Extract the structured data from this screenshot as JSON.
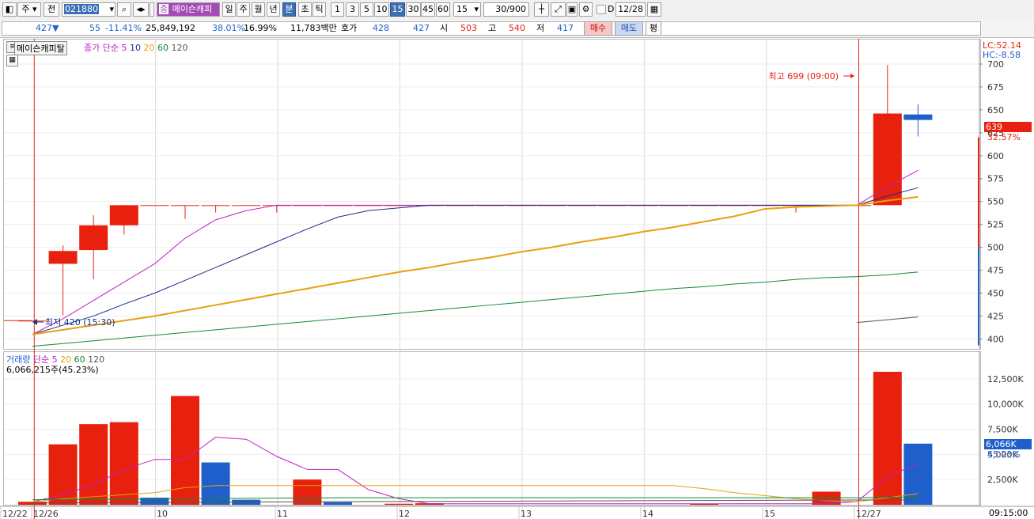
{
  "toolbar": {
    "market_btn": "주",
    "prev_btn": "전",
    "code": "021880",
    "stock_name": "메이슨캐피",
    "periods": [
      "일",
      "주",
      "월",
      "년",
      "분",
      "초",
      "틱"
    ],
    "active_period": "분",
    "intervals": [
      "1",
      "3",
      "5",
      "10",
      "15",
      "30",
      "45",
      "60"
    ],
    "active_interval": "15",
    "interval_select": "15",
    "count_value": "30",
    "count_total": "/900",
    "d_label": "D",
    "date_value": "12/28"
  },
  "infobar": {
    "price": "427",
    "price_arrow": "▼",
    "change": "55",
    "change_pct": "-11.41%",
    "volume": "25,849,192",
    "volume_ratio": "38.01%",
    "turnover": "16.99%",
    "amount": "11,783백만",
    "hoga_label": "호가",
    "hoga_ask": "428",
    "hoga_bid": "427",
    "open_label": "시",
    "open": "503",
    "high_label": "고",
    "high": "540",
    "low_label": "저",
    "low": "417",
    "buy_btn": "매수",
    "sell_btn": "매도",
    "avg_btn": "평"
  },
  "price_panel": {
    "stock_label": "메이슨캐피탈",
    "ma_title": "종가 단순",
    "ma_periods": [
      "5",
      "10",
      "20",
      "60",
      "120"
    ],
    "lc": "LC:52.14",
    "hc": "HC:-8.58",
    "current_price_tag": "639",
    "current_pct": "32.57%",
    "annotation_high": "최고 699 (09:00)",
    "annotation_low": "최저 420 (15:30)"
  },
  "volume_panel": {
    "title": "거래량",
    "ma_title": "단순",
    "ma_periods": [
      "5",
      "20",
      "60",
      "120"
    ],
    "volume_text": "6,066,215주(45.23%)",
    "current_tag": "6,066K",
    "current_pct": "45.23%"
  },
  "time_axis": {
    "labels": [
      "12/22",
      "12/26",
      "10",
      "11",
      "12",
      "13",
      "14",
      "15",
      "12/27"
    ],
    "clock": "09:15:00"
  },
  "colors": {
    "up": "#e8210f",
    "down": "#1f5fcc",
    "ma5": "#c020c0",
    "ma10": "#1a2d8c",
    "ma20": "#e8a010",
    "ma60": "#0f8a35",
    "ma120": "#555555"
  },
  "chart_data": [
    {
      "type": "candlestick",
      "title": "메이슨캐피탈",
      "ylim": [
        390,
        725
      ],
      "y_ticks": [
        400,
        425,
        450,
        475,
        500,
        525,
        550,
        575,
        600,
        625,
        650,
        675,
        700
      ],
      "x": [
        "12/22 15:30",
        "12/26 09:00",
        "12/26 09:15",
        "12/26 09:30",
        "12/26 09:45",
        "12/26 10:00",
        "12/26 10:15",
        "12/26 10:30",
        "12/26 10:45",
        "12/26 11:00",
        "12/26 11:15",
        "12/26 11:30",
        "12/26 11:45",
        "12/26 12:00",
        "12/26 12:15",
        "12/26 12:30",
        "12/26 12:45",
        "12/26 13:00",
        "12/26 13:15",
        "12/26 13:30",
        "12/26 13:45",
        "12/26 14:00",
        "12/26 14:15",
        "12/26 14:30",
        "12/26 14:45",
        "12/26 15:00",
        "12/26 15:15",
        "12/26 15:30",
        "12/27 09:00",
        "12/27 09:15"
      ],
      "open": [
        420,
        482,
        497,
        524,
        546,
        546,
        546,
        546,
        546,
        546,
        546,
        546,
        546,
        546,
        546,
        546,
        546,
        546,
        546,
        546,
        546,
        546,
        546,
        546,
        546,
        546,
        546,
        546,
        546,
        645
      ],
      "high": [
        420,
        502,
        535,
        546,
        546,
        546,
        546,
        546,
        546,
        546,
        546,
        546,
        546,
        546,
        546,
        546,
        546,
        546,
        546,
        546,
        546,
        546,
        546,
        546,
        546,
        546,
        546,
        546,
        699,
        656
      ],
      "low": [
        420,
        426,
        465,
        514,
        546,
        531,
        538,
        546,
        538,
        546,
        546,
        546,
        546,
        546,
        546,
        546,
        546,
        546,
        546,
        546,
        546,
        546,
        546,
        546,
        546,
        538,
        546,
        546,
        617,
        621
      ],
      "close": [
        420,
        496,
        524,
        546,
        546,
        546,
        546,
        546,
        546,
        546,
        546,
        546,
        546,
        546,
        546,
        546,
        546,
        546,
        546,
        546,
        546,
        546,
        546,
        546,
        546,
        546,
        546,
        546,
        646,
        639
      ],
      "series": [
        {
          "name": "5",
          "values": [
            405,
            422,
            442,
            462,
            482,
            510,
            530,
            540,
            546,
            546,
            546,
            546,
            546,
            546,
            546,
            546,
            546,
            546,
            546,
            546,
            546,
            546,
            546,
            546,
            546,
            546,
            546,
            546,
            566,
            584
          ]
        },
        {
          "name": "10",
          "values": [
            405,
            415,
            425,
            438,
            450,
            464,
            478,
            492,
            506,
            520,
            533,
            540,
            543,
            546,
            546,
            546,
            546,
            546,
            546,
            546,
            546,
            546,
            546,
            546,
            546,
            546,
            546,
            546,
            556,
            565
          ]
        },
        {
          "name": "20",
          "values": [
            405,
            410,
            415,
            420,
            425,
            431,
            437,
            443,
            449,
            455,
            461,
            467,
            473,
            478,
            484,
            489,
            495,
            500,
            506,
            511,
            517,
            522,
            528,
            534,
            542,
            544,
            545,
            546,
            551,
            555
          ]
        },
        {
          "name": "60",
          "values": [
            392,
            395,
            398,
            401,
            404,
            407,
            410,
            413,
            416,
            419,
            422,
            425,
            428,
            431,
            434,
            437,
            440,
            443,
            446,
            449,
            452,
            455,
            457,
            460,
            462,
            465,
            467,
            468,
            470,
            473
          ]
        },
        {
          "name": "120",
          "values": [
            null,
            null,
            null,
            null,
            null,
            null,
            null,
            null,
            null,
            null,
            null,
            null,
            null,
            null,
            null,
            null,
            null,
            null,
            null,
            null,
            null,
            null,
            null,
            null,
            null,
            null,
            null,
            418,
            421,
            424
          ]
        }
      ]
    },
    {
      "type": "bar",
      "title": "거래량",
      "ylim": [
        0,
        15000
      ],
      "y_ticks": [
        2500,
        5000,
        7500,
        10000,
        12500
      ],
      "y_tick_labels": [
        "2,500K",
        "5,000K",
        "7,500K",
        "10,000K",
        "12,500K"
      ],
      "values": [
        300,
        6000,
        8000,
        8200,
        700,
        10800,
        4200,
        500,
        0,
        2500,
        250,
        0,
        100,
        150,
        0,
        0,
        0,
        0,
        0,
        0,
        0,
        0,
        100,
        0,
        0,
        0,
        1300,
        0,
        13200,
        6066
      ],
      "up": [
        true,
        true,
        true,
        true,
        false,
        true,
        false,
        false,
        true,
        true,
        false,
        true,
        true,
        true,
        true,
        true,
        true,
        true,
        true,
        true,
        true,
        true,
        true,
        true,
        true,
        true,
        true,
        true,
        true,
        false
      ],
      "series": [
        {
          "name": "5",
          "values": [
            300,
            1000,
            2000,
            3500,
            4500,
            4500,
            6700,
            6500,
            4800,
            3500,
            3500,
            1500,
            600,
            100,
            100,
            100,
            100,
            100,
            100,
            100,
            100,
            100,
            100,
            100,
            100,
            100,
            100,
            300,
            2800,
            4066
          ]
        },
        {
          "name": "20",
          "values": [
            300,
            600,
            800,
            1000,
            1200,
            1700,
            1900,
            1900,
            1900,
            1900,
            1900,
            1900,
            1900,
            1900,
            1900,
            1900,
            1900,
            1900,
            1900,
            1900,
            1900,
            1900,
            1600,
            1200,
            900,
            600,
            400,
            300,
            700,
            1100
          ]
        },
        {
          "name": "60",
          "values": [
            500,
            520,
            540,
            560,
            580,
            600,
            620,
            640,
            660,
            680,
            700,
            700,
            700,
            700,
            700,
            700,
            700,
            700,
            700,
            700,
            700,
            700,
            700,
            700,
            700,
            700,
            700,
            700,
            740,
            780
          ]
        },
        {
          "name": "120",
          "values": [
            200,
            210,
            220,
            230,
            240,
            250,
            260,
            270,
            280,
            290,
            300,
            310,
            320,
            330,
            340,
            350,
            360,
            370,
            380,
            390,
            400,
            410,
            420,
            430,
            440,
            450,
            460,
            470,
            480,
            490
          ]
        }
      ]
    }
  ]
}
